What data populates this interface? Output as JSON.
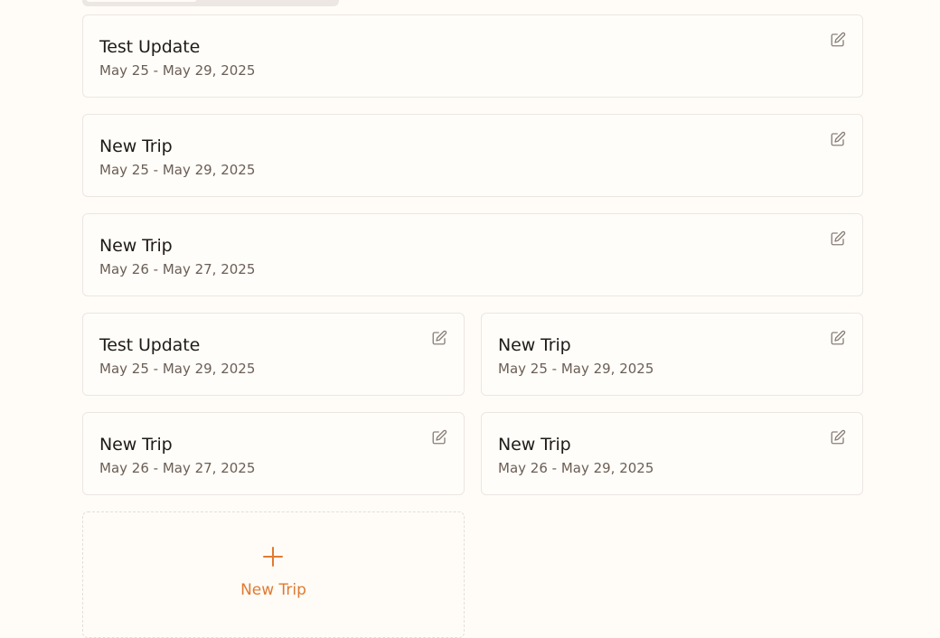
{
  "trips": [
    {
      "title": "Test Update",
      "dates": "May 25 - May 29, 2025"
    },
    {
      "title": "New Trip",
      "dates": "May 25 - May 29, 2025"
    },
    {
      "title": "New Trip",
      "dates": "May 26 - May 27, 2025"
    },
    {
      "title": "Test Update",
      "dates": "May 25 - May 29, 2025"
    },
    {
      "title": "New Trip",
      "dates": "May 25 - May 29, 2025"
    },
    {
      "title": "New Trip",
      "dates": "May 26 - May 27, 2025"
    },
    {
      "title": "New Trip",
      "dates": "May 26 - May 29, 2025"
    }
  ],
  "new_trip": {
    "label": "New Trip",
    "icon": "plus-icon"
  },
  "icons": {
    "edit": "edit-icon"
  },
  "colors": {
    "accent": "#e07a32",
    "background": "#fffcf7",
    "border": "#ebe6e1"
  }
}
